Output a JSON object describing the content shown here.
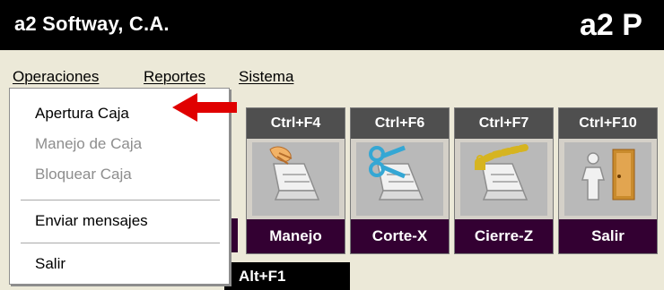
{
  "window": {
    "title": "a2 Softway, C.A.",
    "brand": "a2 P"
  },
  "menubar": {
    "items": [
      {
        "label": "Operaciones"
      },
      {
        "label": "Reportes"
      },
      {
        "label": "Sistema"
      }
    ]
  },
  "dropdown": {
    "items": [
      {
        "label": "Apertura Caja",
        "enabled": true
      },
      {
        "label": "Manejo de Caja",
        "enabled": false
      },
      {
        "label": "Bloquear Caja",
        "enabled": false
      },
      {
        "label": "Enviar mensajes",
        "enabled": true
      },
      {
        "label": "Salir",
        "enabled": true
      }
    ]
  },
  "toolbar": {
    "buttons": [
      {
        "shortcut": "Ctrl+F4",
        "label": "Manejo",
        "icon": "hand-drawer-icon"
      },
      {
        "shortcut": "Ctrl+F6",
        "label": "Corte-X",
        "icon": "scissors-drawer-icon"
      },
      {
        "shortcut": "Ctrl+F7",
        "label": "Cierre-Z",
        "icon": "chain-drawer-icon"
      },
      {
        "shortcut": "Ctrl+F10",
        "label": "Salir",
        "icon": "exit-door-icon"
      }
    ],
    "bottom_shortcut": "Alt+F1"
  },
  "colors": {
    "titlebar": "#000000",
    "button_label_bg": "#330032",
    "shortcut_bg": "#4f4f4f",
    "arrow": "#e00000"
  }
}
